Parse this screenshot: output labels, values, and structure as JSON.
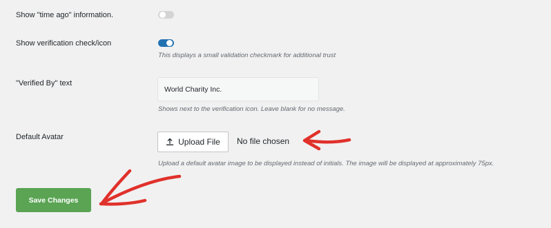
{
  "settings": {
    "time_ago": {
      "label": "Show \"time ago\" information.",
      "enabled": false
    },
    "verification": {
      "label": "Show verification check/icon",
      "enabled": true,
      "description": "This displays a small validation checkmark for additional trust"
    },
    "verified_by": {
      "label": "\"Verified By\" text",
      "value": "World Charity Inc.",
      "description": "Shows next to the verification icon. Leave blank for no message."
    },
    "default_avatar": {
      "label": "Default Avatar",
      "upload_label": "Upload File",
      "file_status": "No file chosen",
      "description": "Upload a default avatar image to be displayed instead of initials. The image will be displayed at approximately 75px."
    }
  },
  "save_button": {
    "label": "Save Changes"
  },
  "colors": {
    "page_background": "#f1f1f1",
    "toggle_on": "#2271b1",
    "toggle_off": "#d4d4d4",
    "save_button": "#5aa454",
    "annotation_arrow": "#e0312b"
  },
  "icons": {
    "upload": "upload-icon",
    "annotation": "red-arrow-icon"
  }
}
